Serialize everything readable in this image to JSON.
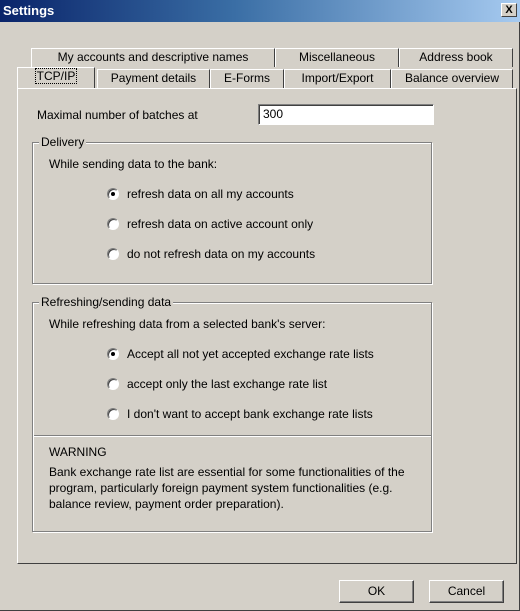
{
  "window": {
    "title": "Settings",
    "close_glyph": "X"
  },
  "tabs_back": [
    {
      "label": "My accounts and descriptive names"
    },
    {
      "label": "Miscellaneous"
    },
    {
      "label": "Address book"
    }
  ],
  "tabs_front": [
    {
      "label": "TCP/IP",
      "active": true
    },
    {
      "label": "Payment details"
    },
    {
      "label": "E-Forms"
    },
    {
      "label": "Import/Export"
    },
    {
      "label": "Balance overview"
    }
  ],
  "batches": {
    "label": "Maximal number of batches at",
    "value": "300"
  },
  "delivery": {
    "legend": "Delivery",
    "prompt": "While sending data to the bank:",
    "options": [
      {
        "label": "refresh data on all my accounts",
        "selected": true
      },
      {
        "label": "refresh data on active account only",
        "selected": false
      },
      {
        "label": "do not refresh data on my accounts",
        "selected": false
      }
    ]
  },
  "refreshing": {
    "legend": "Refreshing/sending data",
    "prompt": "While refreshing data from a selected bank's server:",
    "options": [
      {
        "label": "Accept all not yet accepted exchange rate lists",
        "selected": true
      },
      {
        "label": "accept only the last exchange rate list",
        "selected": false
      },
      {
        "label": "I don't want to accept bank exchange rate lists",
        "selected": false
      }
    ],
    "warning_title": "WARNING",
    "warning_text": "Bank exchange rate list are essential for some functionalities of the program, particularly foreign payment system functionalities (e.g. balance review, payment order preparation)."
  },
  "buttons": {
    "ok": "OK",
    "cancel": "Cancel"
  }
}
